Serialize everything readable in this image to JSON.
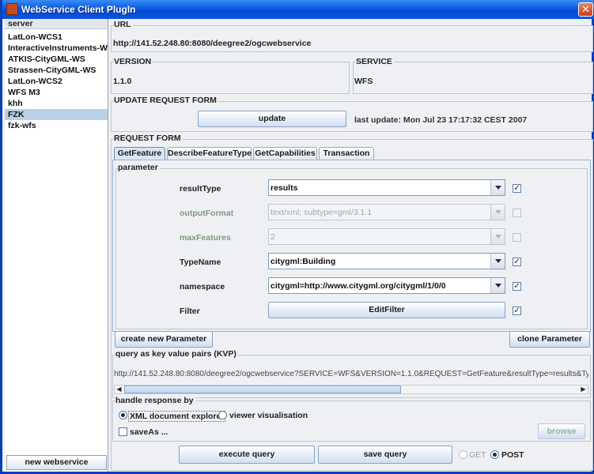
{
  "window": {
    "title": "WebService Client PlugIn",
    "close_glyph": "✕"
  },
  "server_panel": {
    "header": "server",
    "items": [
      {
        "label": "LatLon-WCS1"
      },
      {
        "label": "InteractiveInstruments-WFS"
      },
      {
        "label": "ATKIS-CityGML-WS"
      },
      {
        "label": "Strassen-CityGML-WS"
      },
      {
        "label": "LatLon-WCS2"
      },
      {
        "label": "WFS M3"
      },
      {
        "label": "khh"
      },
      {
        "label": "FZK"
      },
      {
        "label": "fzk-wfs"
      }
    ],
    "selected_index": 7,
    "new_button": "new webservice"
  },
  "url_section": {
    "title": "URL",
    "value": "http://141.52.248.80:8080/deegree2/ogcwebservice"
  },
  "version_section": {
    "title": "VERSION",
    "value": "1.1.0"
  },
  "service_section": {
    "title": "SERVICE",
    "value": "WFS"
  },
  "update_section": {
    "title": "UPDATE REQUEST FORM",
    "button": "update",
    "last_update": "last update: Mon Jul 23 17:17:32 CEST 2007"
  },
  "request_form": {
    "title": "REQUEST FORM",
    "tabs": [
      "GetFeature",
      "DescribeFeatureType",
      "GetCapabilities",
      "Transaction"
    ],
    "active_tab": "GetFeature",
    "parameter_title": "parameter",
    "params": [
      {
        "label": "resultType",
        "value": "results",
        "enabled": true,
        "checked": true
      },
      {
        "label": "outputFormat",
        "value": "text/xml; subtype=gml/3.1.1",
        "enabled": false,
        "checked": false
      },
      {
        "label": "maxFeatures",
        "value": "2",
        "enabled": false,
        "checked": false
      },
      {
        "label": "TypeName",
        "value": "citygml:Building",
        "enabled": true,
        "checked": true
      },
      {
        "label": "namespace",
        "value": "citygml=http://www.citygml.org/citygml/1/0/0",
        "enabled": true,
        "checked": true
      }
    ],
    "filter": {
      "label": "Filter",
      "button": "EditFilter",
      "checked": true
    },
    "create_param_button": "create new Parameter",
    "clone_param_button": "clone Parameter"
  },
  "kvp": {
    "title": "query as key value pairs (KVP)",
    "value": "http://141.52.248.80:8080/deegree2/ogcwebservice?SERVICE=WFS&VERSION=1.1.0&REQUEST=GetFeature&resultType=results&TypeName=citygml:Building"
  },
  "response": {
    "title": "handle response by",
    "xml_explorer": "XML document explorer",
    "viewer": "viewer visualisation",
    "save_as": "saveAs ...",
    "browse": "browse"
  },
  "actions": {
    "execute": "execute query",
    "save": "save query",
    "get": "GET",
    "post": "POST"
  },
  "colors": {
    "titlebar": "#0a5ae0",
    "selection": "#b8cfe5",
    "disabled_label": "#7c9c7c"
  }
}
